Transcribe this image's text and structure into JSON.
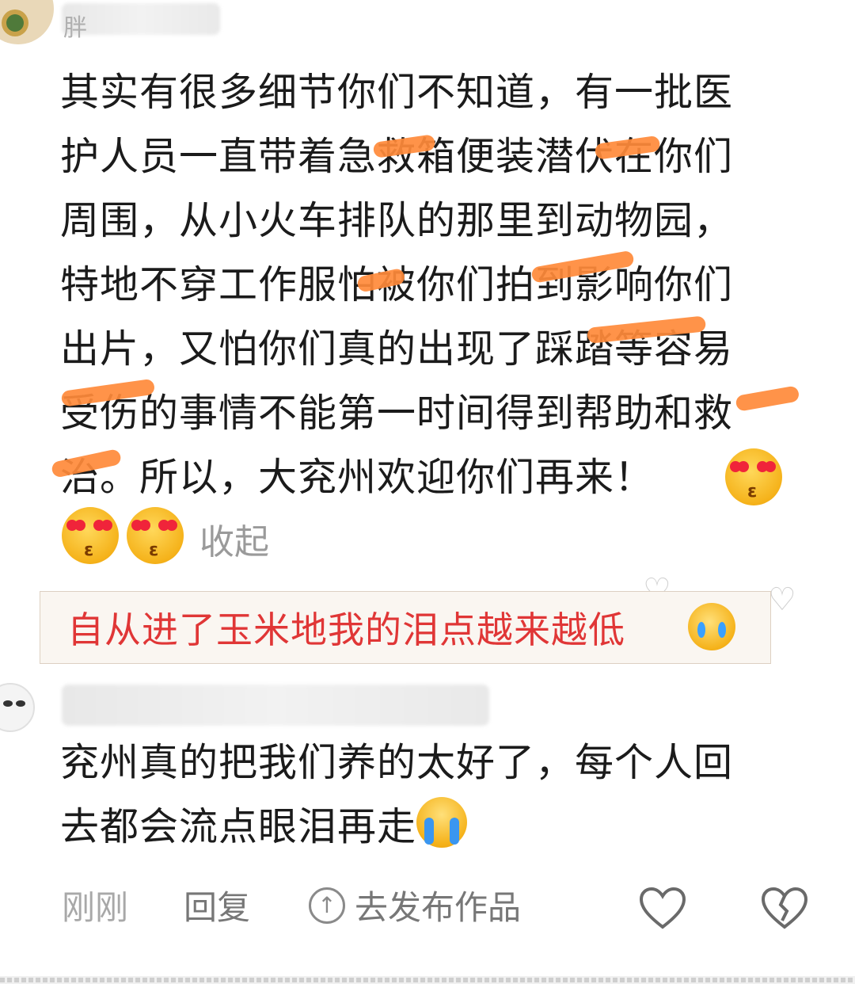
{
  "comment1": {
    "username_char": "胖",
    "lines": [
      "其实有很多细节你们不知道，有一批医",
      "护人员一直带着急救箱便装潜伏在你们",
      "周围，从小火车排队的那里到动物园，",
      "特地不穿工作服怕被你们拍到影响你们",
      "出片，又怕你们真的出现了踩踏等容易",
      "受伤的事情不能第一时间得到帮助和救",
      "治。所以，大兖州欢迎你们再来！"
    ],
    "emoji": "heart-eyes-kiss-emoji",
    "collapse_label": "收起"
  },
  "banner": {
    "text": "自从进了玉米地我的泪点越来越低",
    "emoji": "holding-back-tears-emoji",
    "text_color": "#e03636"
  },
  "comment2": {
    "line1": "兖州真的把我们养的太好了，每个人回",
    "line2": "去都会流点眼泪再走",
    "emoji": "loudly-crying-emoji"
  },
  "footer": {
    "time": "刚刚",
    "reply": "回复",
    "publish": "去发布作品",
    "like_icon": "heart-outline-icon",
    "dislike_icon": "broken-heart-icon"
  },
  "colors": {
    "redaction": "#ff8a3a",
    "body_text": "#1b1b1b",
    "muted": "#9a9a9a"
  }
}
